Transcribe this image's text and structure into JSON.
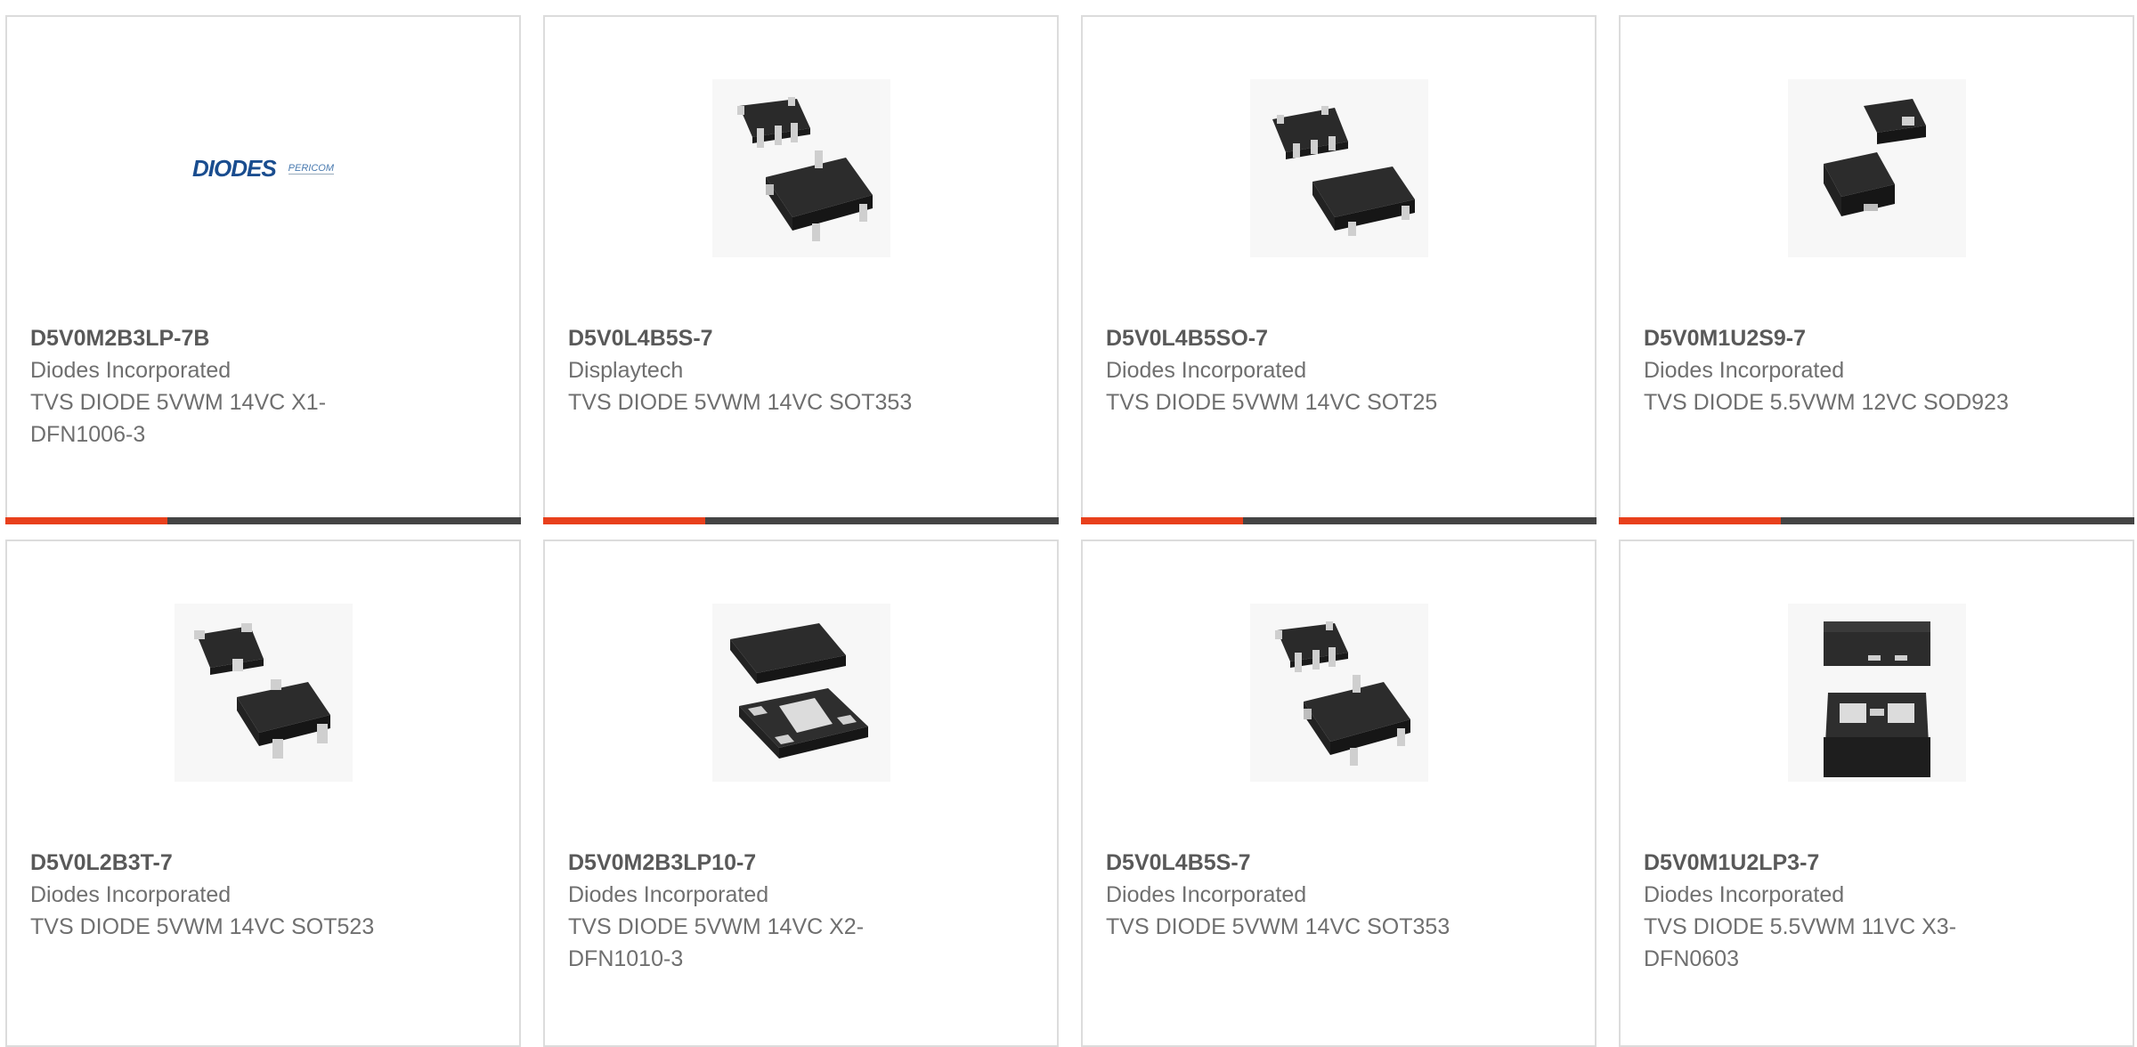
{
  "products": [
    {
      "part_number": "D5V0M2B3LP-7B",
      "manufacturer": "Diodes Incorporated",
      "description": "TVS DIODE 5VWM 14VC X1-DFN1006-3",
      "image": "diodes-pericom-logo",
      "logo_text": "DIODES",
      "logo_sub": "PERICOM"
    },
    {
      "part_number": "D5V0L4B5S-7",
      "manufacturer": "Displaytech",
      "description": "TVS DIODE 5VWM 14VC SOT353",
      "image": "sot353-package"
    },
    {
      "part_number": "D5V0L4B5SO-7",
      "manufacturer": "Diodes Incorporated",
      "description": "TVS DIODE 5VWM 14VC SOT25",
      "image": "sot25-package"
    },
    {
      "part_number": "D5V0M1U2S9-7",
      "manufacturer": "Diodes Incorporated",
      "description": "TVS DIODE 5.5VWM 12VC SOD923",
      "image": "sod923-package"
    },
    {
      "part_number": "D5V0L2B3T-7",
      "manufacturer": "Diodes Incorporated",
      "description": "TVS DIODE 5VWM 14VC SOT523",
      "image": "sot523-package"
    },
    {
      "part_number": "D5V0M2B3LP10-7",
      "manufacturer": "Diodes Incorporated",
      "description": "TVS DIODE 5VWM 14VC X2-DFN1010-3",
      "image": "dfn1010-package"
    },
    {
      "part_number": "D5V0L4B5S-7",
      "manufacturer": "Diodes Incorporated",
      "description": "TVS DIODE 5VWM 14VC SOT353",
      "image": "sot353-package"
    },
    {
      "part_number": "D5V0M1U2LP3-7",
      "manufacturer": "Diodes Incorporated",
      "description": "TVS DIODE 5.5VWM 11VC X3-DFN0603",
      "image": "dfn0603-package"
    }
  ],
  "colors": {
    "accent": "#e8401c",
    "bar": "#444444",
    "border": "#dcdcdc",
    "part_number": "#595959",
    "text": "#6f6f6f"
  }
}
